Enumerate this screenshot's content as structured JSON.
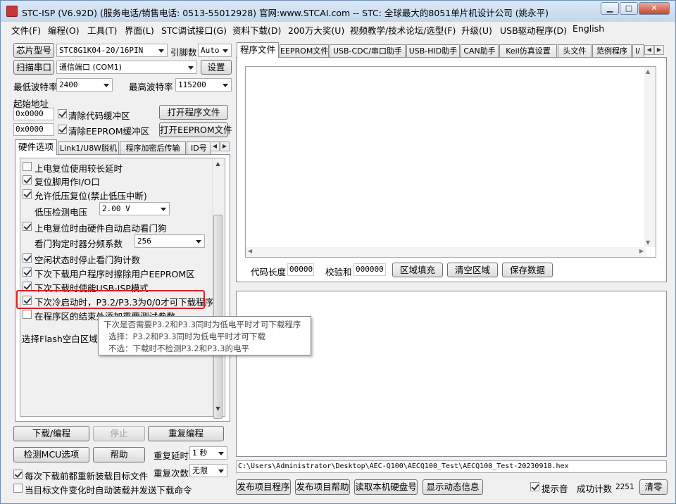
{
  "window": {
    "title": "STC-ISP (V6.92D) (服务电话/销售电话: 0513-55012928) 官网:www.STCAI.com  -- STC: 全球最大的8051单片机设计公司 (姚永平)"
  },
  "menu": [
    "文件(F)",
    "编程(O)",
    "工具(T)",
    "界面(L)",
    "STC调试接口(G)",
    "资料下载(D)",
    "200万大奖(U)",
    "视频教学/技术论坛/选型(F)",
    "升级(U)",
    "USB驱动程序(D)",
    "English"
  ],
  "left": {
    "chip_type_button": "芯片型号",
    "chip_type_value": "STC8G1K04-20/16PIN",
    "pin_label": "引脚数",
    "pin_value": "Auto",
    "scan_port_button": "扫描串口",
    "port_value": "通信端口 (COM1)",
    "settings_button": "设置",
    "min_baud_label": "最低波特率",
    "min_baud_value": "2400",
    "max_baud_label": "最高波特率",
    "max_baud_value": "115200",
    "start_addr_label": "起始地址",
    "addr1_value": "0x0000",
    "clear_code_label": "清除代码缓冲区",
    "open_program_button": "打开程序文件",
    "addr2_value": "0x0000",
    "clear_eeprom_label": "清除EEPROM缓冲区",
    "open_eeprom_button": "打开EEPROM文件",
    "tabs": [
      "硬件选项",
      "Link1/U8W脱机",
      "程序加密后传输",
      "ID号"
    ],
    "options": [
      {
        "label": "上电复位使用较长延时",
        "checked": false
      },
      {
        "label": "复位脚用作I/O口",
        "checked": true
      },
      {
        "label": "允许低压复位(禁止低压中断)",
        "checked": true
      },
      {
        "label": "上电复位时由硬件自动启动看门狗",
        "checked": true
      },
      {
        "label": "空闲状态时停止看门狗计数",
        "checked": true
      },
      {
        "label": "下次下载用户程序时擦除用户EEPROM区",
        "checked": true
      },
      {
        "label": "下次下载时使能USB-ISP模式",
        "checked": true
      },
      {
        "label": "下次冷启动时，P3.2/P3.3为0/0才可下载程序",
        "checked": true
      },
      {
        "label": "在程序区的结束处添加重要测试参数",
        "checked": false
      }
    ],
    "low_voltage_label": "低压检测电压",
    "low_voltage_value": "2.00 V",
    "wdt_label": "看门狗定时器分频系数",
    "wdt_value": "256",
    "flash_fill_label": "选择Flash空白区域的",
    "tooltip": {
      "line1": "下次是否需要P3.2和P3.3同时为低电平时才可下载程序",
      "line2": "选择：P3.2和P3.3同时为低电平时才可下载",
      "line3": "不选：下载时不检测P3.2和P3.3的电平"
    },
    "download_button": "下载/编程",
    "stop_button": "停止",
    "reprogram_button": "重复编程",
    "check_mcu_button": "检测MCU选项",
    "help_button": "帮助",
    "repeat_delay_label": "重复延时",
    "repeat_delay_value": "1 秒",
    "repeat_count_label": "重复次数",
    "repeat_count_value": "无限",
    "reload_label": "每次下载前都重新装载目标文件",
    "reload_checked": true,
    "auto_download_label": "当目标文件变化时自动装载并发送下载命令",
    "auto_download_checked": false
  },
  "right": {
    "tabs": [
      "程序文件",
      "EEPROM文件",
      "USB-CDC/串口助手",
      "USB-HID助手",
      "CAN助手",
      "Keil仿真设置",
      "头文件",
      "范例程序",
      "I/"
    ],
    "code_length_label": "代码长度",
    "code_length_value": "00000",
    "checksum_label": "校验和",
    "checksum_value": "000000",
    "fill_button": "区域填充",
    "clear_button": "清空区域",
    "save_button": "保存数据",
    "file_path": "C:\\Users\\Administrator\\Desktop\\AEC-Q100\\AECQ100_Test\\AECQ100_Test-20230918.hex",
    "publish_program_button": "发布项目程序",
    "publish_help_button": "发布项目帮助",
    "read_disk_button": "读取本机硬盘号",
    "show_anim_button": "显示动态信息",
    "beep_label": "提示音",
    "beep_checked": true,
    "success_label": "成功计数",
    "success_value": "2251",
    "clear_count_button": "清零"
  },
  "colors": {
    "highlight": "#e02020",
    "titlebar": "#c4d8ee",
    "tooltip_bg": "#ffffff"
  }
}
